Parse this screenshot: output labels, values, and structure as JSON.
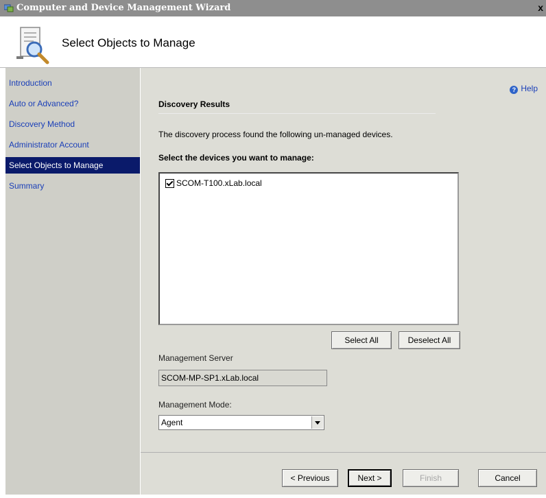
{
  "window": {
    "title": "Computer and Device Management Wizard",
    "close_glyph": "x"
  },
  "header": {
    "page_title": "Select Objects to Manage",
    "icon": "wizard-search-icon"
  },
  "sidebar": {
    "items": [
      {
        "label": "Introduction",
        "selected": false
      },
      {
        "label": "Auto or Advanced?",
        "selected": false
      },
      {
        "label": "Discovery Method",
        "selected": false
      },
      {
        "label": "Administrator Account",
        "selected": false
      },
      {
        "label": "Select Objects to Manage",
        "selected": true
      },
      {
        "label": "Summary",
        "selected": false
      }
    ]
  },
  "main": {
    "help_label": "Help",
    "section_heading": "Discovery Results",
    "description": "The discovery process found the following un-managed devices.",
    "select_label": "Select the devices you want to manage:",
    "devices": [
      {
        "label": "SCOM-T100.xLab.local",
        "checked": true
      }
    ],
    "select_all_label": "Select All",
    "deselect_all_label": "Deselect All",
    "management_server_label": "Management Server",
    "management_server_value": "SCOM-MP-SP1.xLab.local",
    "management_mode_label": "Management Mode:",
    "management_mode_value": "Agent"
  },
  "footer": {
    "previous_label": "< Previous",
    "next_label": "Next >",
    "finish_label": "Finish",
    "cancel_label": "Cancel"
  },
  "colors": {
    "sidebar_bg": "#cfcfc8",
    "selected_bg": "#0a1a6a",
    "link": "#1a3fb8",
    "content_bg": "#ddddd6"
  }
}
